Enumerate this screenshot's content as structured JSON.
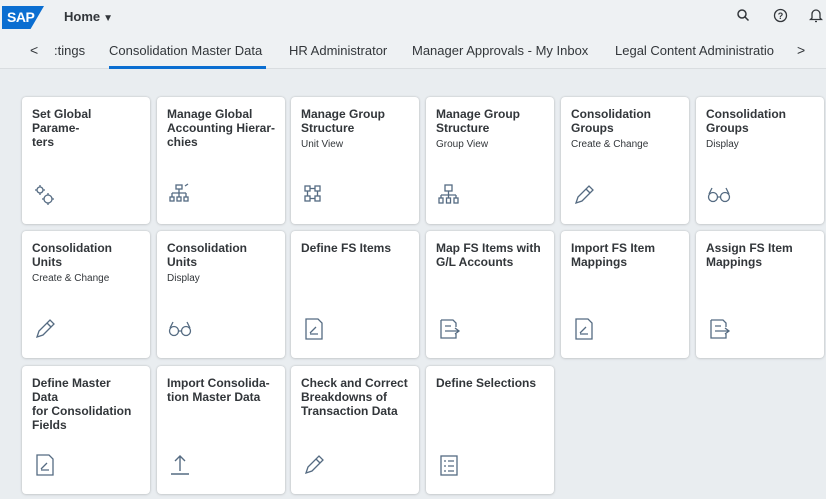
{
  "header": {
    "logo": "SAP",
    "home_label": "Home",
    "icons": [
      "search-icon",
      "help-icon",
      "notifications-icon"
    ],
    "icon_glyphs": [
      "⚲",
      "?",
      "🔔"
    ]
  },
  "tabs": {
    "prev_arrow": "<",
    "next_arrow": ">",
    "items": [
      {
        "label": ":tings"
      },
      {
        "label": "Consolidation Master Data"
      },
      {
        "label": "HR Administrator"
      },
      {
        "label": "Manager Approvals - My Inbox"
      },
      {
        "label": "Legal Content Administratio"
      }
    ],
    "active_index": 1
  },
  "tiles": [
    {
      "title": "Set Global Parame-\nters",
      "subtitle": "",
      "icon": "settings-gears-icon"
    },
    {
      "title": "Manage Global\nAccounting Hierar-\nchies",
      "subtitle": "",
      "icon": "hierarchy-icon"
    },
    {
      "title": "Manage Group\nStructure",
      "subtitle": "Unit View",
      "icon": "network-icon"
    },
    {
      "title": "Manage Group\nStructure",
      "subtitle": "Group View",
      "icon": "org-chart-icon"
    },
    {
      "title": "Consolidation\nGroups",
      "subtitle": "Create & Change",
      "icon": "edit-pencil-icon"
    },
    {
      "title": "Consolidation\nGroups",
      "subtitle": "Display",
      "icon": "glasses-icon"
    },
    {
      "title": "Consolidation Units",
      "subtitle": "Create & Change",
      "icon": "edit-pencil-icon"
    },
    {
      "title": "Consolidation Units",
      "subtitle": "Display",
      "icon": "glasses-icon"
    },
    {
      "title": "Define FS Items",
      "subtitle": "",
      "icon": "document-edit-icon"
    },
    {
      "title": "Map FS Items with\nG/L Accounts",
      "subtitle": "",
      "icon": "document-map-icon"
    },
    {
      "title": "Import FS Item\nMappings",
      "subtitle": "",
      "icon": "document-edit-icon"
    },
    {
      "title": "Assign FS Item\nMappings",
      "subtitle": "",
      "icon": "document-map-icon"
    },
    {
      "title": "Define Master Data\nfor Consolidation\nFields",
      "subtitle": "",
      "icon": "document-edit-icon"
    },
    {
      "title": "Import Consolida-\ntion Master Data",
      "subtitle": "",
      "icon": "upload-icon"
    },
    {
      "title": "Check and Correct\nBreakdowns of\nTransaction Data",
      "subtitle": "",
      "icon": "edit-pencil-icon"
    },
    {
      "title": "Define Selections",
      "subtitle": "",
      "icon": "checklist-icon"
    }
  ],
  "colors": {
    "accent": "#0a6ed1",
    "icon": "#556b82",
    "background": "#e9edf0"
  }
}
